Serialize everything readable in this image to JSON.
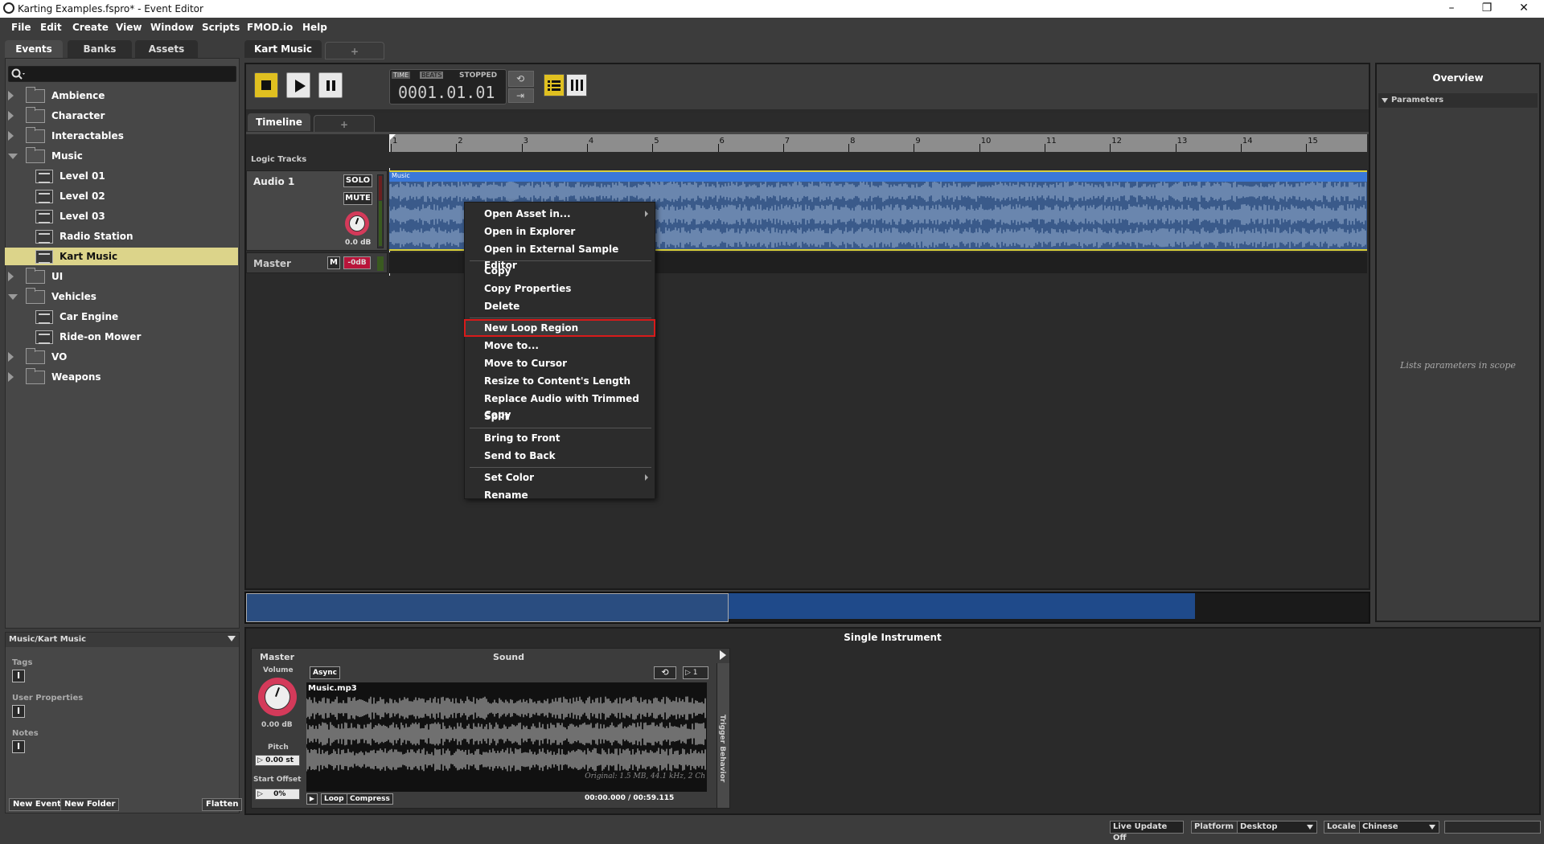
{
  "window": {
    "title": "Karting Examples.fspro* - Event Editor"
  },
  "menu": [
    "File",
    "Edit",
    "Create",
    "View",
    "Window",
    "Scripts",
    "FMOD.io",
    "Help"
  ],
  "browser": {
    "tabs": [
      "Events",
      "Banks",
      "Assets"
    ],
    "active_tab": "Events",
    "tree": [
      {
        "label": "Ambience",
        "type": "folder",
        "expanded": false,
        "depth": 0
      },
      {
        "label": "Character",
        "type": "folder",
        "expanded": false,
        "depth": 0
      },
      {
        "label": "Interactables",
        "type": "folder",
        "expanded": false,
        "depth": 0
      },
      {
        "label": "Music",
        "type": "folder",
        "expanded": true,
        "depth": 0
      },
      {
        "label": "Level 01",
        "type": "event",
        "depth": 1
      },
      {
        "label": "Level 02",
        "type": "event",
        "depth": 1
      },
      {
        "label": "Level 03",
        "type": "event",
        "depth": 1
      },
      {
        "label": "Radio Station",
        "type": "event",
        "depth": 1
      },
      {
        "label": "Kart Music",
        "type": "event",
        "depth": 1,
        "selected": true
      },
      {
        "label": "UI",
        "type": "folder",
        "expanded": false,
        "depth": 0
      },
      {
        "label": "Vehicles",
        "type": "folder",
        "expanded": true,
        "depth": 0
      },
      {
        "label": "Car Engine",
        "type": "event",
        "depth": 1
      },
      {
        "label": "Ride-on Mower",
        "type": "event",
        "depth": 1
      },
      {
        "label": "VO",
        "type": "folder",
        "expanded": false,
        "depth": 0
      },
      {
        "label": "Weapons",
        "type": "folder",
        "expanded": false,
        "depth": 0
      }
    ]
  },
  "properties": {
    "path": "Music/Kart Music",
    "tags_label": "Tags",
    "user_props_label": "User Properties",
    "notes_label": "Notes",
    "new_event": "New Event",
    "new_folder": "New Folder",
    "flatten": "Flatten"
  },
  "editor": {
    "event_tab": "Kart Music",
    "add_tab": "+",
    "time_label": "TIME",
    "beats_label": "BEATS",
    "state": "STOPPED",
    "position": "0001.01.01",
    "sub_tab": "Timeline",
    "logic_tracks": "Logic Tracks",
    "ruler_ticks": [
      "1",
      "2",
      "3",
      "4",
      "5",
      "6",
      "7",
      "8",
      "9",
      "10",
      "11",
      "12",
      "13",
      "14",
      "15"
    ],
    "track_name": "Audio 1",
    "solo": "SOLO",
    "mute": "MUTE",
    "track_volume": "0.0 dB",
    "master_name": "Master",
    "master_m": "M",
    "master_value": "-0dB",
    "region_label": "Music"
  },
  "context_menu": {
    "items": [
      {
        "label": "Open Asset in...",
        "submenu": true
      },
      {
        "label": "Open in Explorer"
      },
      {
        "label": "Open in External Sample Editor"
      },
      {
        "sep": true
      },
      {
        "label": "Copy"
      },
      {
        "label": "Copy Properties"
      },
      {
        "label": "Delete"
      },
      {
        "sep": true
      },
      {
        "label": "New Loop Region",
        "highlighted": true
      },
      {
        "label": "Move to..."
      },
      {
        "label": "Move to Cursor"
      },
      {
        "label": "Resize to Content's Length"
      },
      {
        "label": "Replace Audio with Trimmed Copy"
      },
      {
        "label": "Split"
      },
      {
        "sep": true
      },
      {
        "label": "Bring to Front"
      },
      {
        "label": "Send to Back"
      },
      {
        "sep": true
      },
      {
        "label": "Set Color",
        "submenu": true
      },
      {
        "label": "Rename"
      }
    ]
  },
  "overview": {
    "title": "Overview",
    "section": "Parameters",
    "empty_text": "Lists parameters in scope"
  },
  "instrument": {
    "title": "Single Instrument",
    "master": "Master",
    "sound": "Sound",
    "volume_label": "Volume",
    "volume_value": "0.00 dB",
    "pitch_label": "Pitch",
    "pitch_value": "0.00 st",
    "start_offset_label": "Start Offset",
    "start_offset_value": "0%",
    "async": "Async",
    "loop_count": "1",
    "file": "Music.mp3",
    "original": "Original: 1.5 MB, 44.1 kHz, 2 Ch",
    "loop": "Loop",
    "compress": "Compress",
    "time": "00:00.000 / 00:59.115",
    "trigger_behavior": "Trigger Behavior"
  },
  "status": {
    "live_update": "Live Update Off",
    "platform_label": "Platform",
    "platform_value": "Desktop",
    "locale_label": "Locale",
    "locale_value": "Chinese"
  },
  "colors": {
    "accent_yellow": "#dcd48a",
    "region_blue": "#3a78d8",
    "highlight_red": "#d81a1a"
  }
}
